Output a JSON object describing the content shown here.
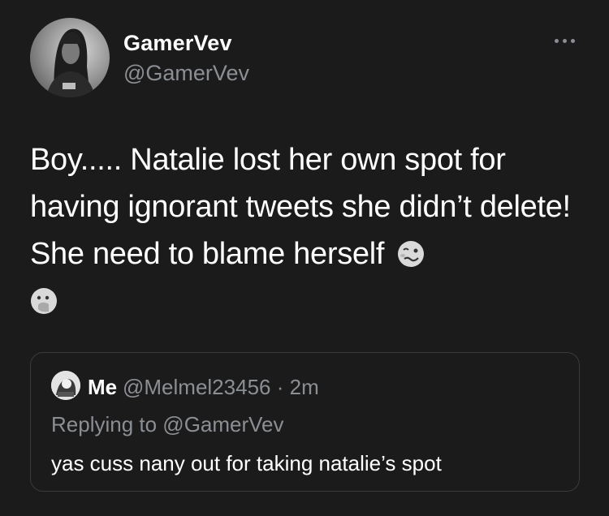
{
  "author": {
    "display_name": "GamerVev",
    "handle": "@GamerVev"
  },
  "tweet": {
    "text": "Boy..... Natalie lost her own spot for having ignorant tweets she didn’t delete! She need to blame herself",
    "emojis": [
      "woozy-face-icon",
      "face-with-hand-over-mouth-icon"
    ]
  },
  "quote": {
    "display_name": "Me",
    "handle": "@Melmel23456",
    "separator": "·",
    "time": "2m",
    "replying_to": "Replying to @GamerVev",
    "text": "yas cuss nany out for taking natalie’s spot"
  },
  "colors": {
    "background": "#1b1b1b",
    "primary_text": "#ffffff",
    "secondary_text": "#8b8f94",
    "border": "#3a3b3c"
  }
}
